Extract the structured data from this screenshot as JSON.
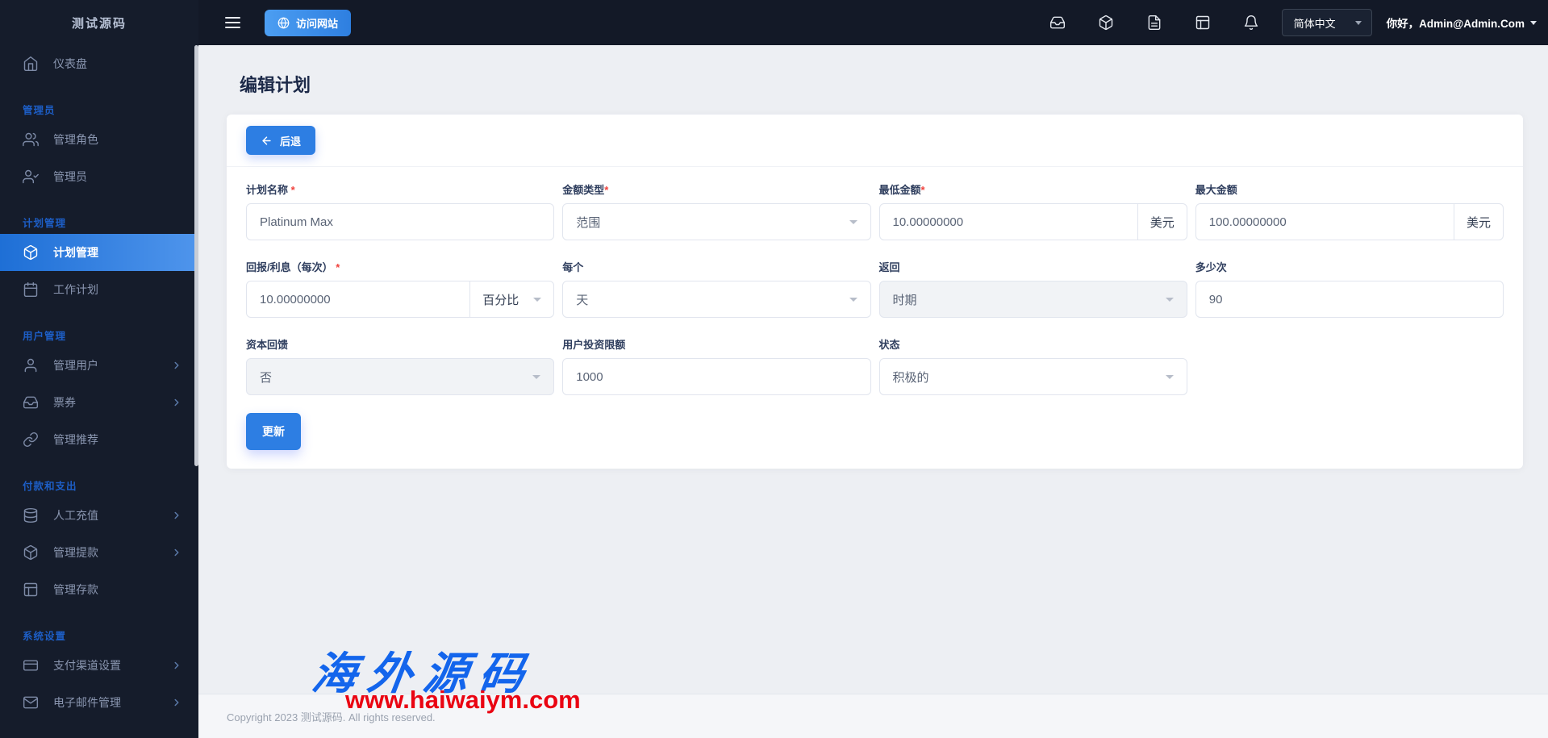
{
  "colors": {
    "accent_blue": "#2d7ee3",
    "sidebar_bg": "#151c2b",
    "topbar_bg": "#131927",
    "active_gradient_start": "#1e6fd6",
    "active_gradient_end": "#4f95ec",
    "watermark_blue": "#1365ec",
    "watermark_red": "#ea0412",
    "required_red": "#f0413c"
  },
  "sidebar": {
    "logo": "测试源码",
    "sections": [
      {
        "label": "",
        "items": [
          {
            "label": "仪表盘",
            "icon": "home-icon"
          }
        ]
      },
      {
        "label": "管理员",
        "items": [
          {
            "label": "管理角色",
            "icon": "users-icon"
          },
          {
            "label": "管理员",
            "icon": "user-check-icon"
          }
        ]
      },
      {
        "label": "计划管理",
        "items": [
          {
            "label": "计划管理",
            "icon": "cube-icon"
          },
          {
            "label": "工作计划",
            "icon": "calendar-icon"
          }
        ]
      },
      {
        "label": "用户管理",
        "items": [
          {
            "label": "管理用户",
            "icon": "user-icon"
          },
          {
            "label": "票券",
            "icon": "inbox-icon"
          },
          {
            "label": "管理推荐",
            "icon": "link-icon"
          }
        ]
      },
      {
        "label": "付款和支出",
        "items": [
          {
            "label": "人工充值",
            "icon": "database-icon"
          },
          {
            "label": "管理提款",
            "icon": "cube-icon"
          },
          {
            "label": "管理存款",
            "icon": "grid-icon"
          }
        ]
      },
      {
        "label": "系统设置",
        "items": [
          {
            "label": "支付渠道设置",
            "icon": "credit-card-icon"
          },
          {
            "label": "电子邮件管理",
            "icon": "mail-icon"
          }
        ]
      }
    ]
  },
  "topbar": {
    "visit_site_label": "访问网站",
    "language": "简体中文",
    "greeting": "你好，Admin@Admin.Com",
    "icons": [
      "inbox-icon",
      "cube-icon",
      "file-text-icon",
      "grid-icon",
      "bell-icon"
    ]
  },
  "page": {
    "title": "编辑计划",
    "back_label": "后退",
    "update_label": "更新"
  },
  "form": {
    "required_mark": "*",
    "fields": [
      {
        "label": "计划名称 ",
        "value": "Platinum Max",
        "required": true
      },
      {
        "label": "金额类型",
        "value": "范围",
        "required": true
      },
      {
        "label": "最低金额",
        "value": "10.00000000",
        "addon": "美元",
        "required": true
      },
      {
        "label": "最大金额",
        "value": "100.00000000",
        "addon": "美元",
        "required": false
      },
      {
        "label": "回报/利息（每次） ",
        "value": "10.00000000",
        "addon": "百分比",
        "required": true
      },
      {
        "label": "每个",
        "value": "天",
        "required": false
      },
      {
        "label": "返回",
        "value": "时期",
        "required": false
      },
      {
        "label": "多少次",
        "value": "90",
        "required": false
      },
      {
        "label": "资本回馈",
        "value": "否",
        "required": false
      },
      {
        "label": "用户投资限额",
        "value": "1000",
        "required": false
      },
      {
        "label": "状态",
        "value": "积极的",
        "required": false
      }
    ]
  },
  "footer": {
    "copyright": "Copyright 2023 测试源码. All rights reserved."
  },
  "watermark": {
    "line1": "海外源码",
    "line2": "www.haiwaiym.com"
  }
}
